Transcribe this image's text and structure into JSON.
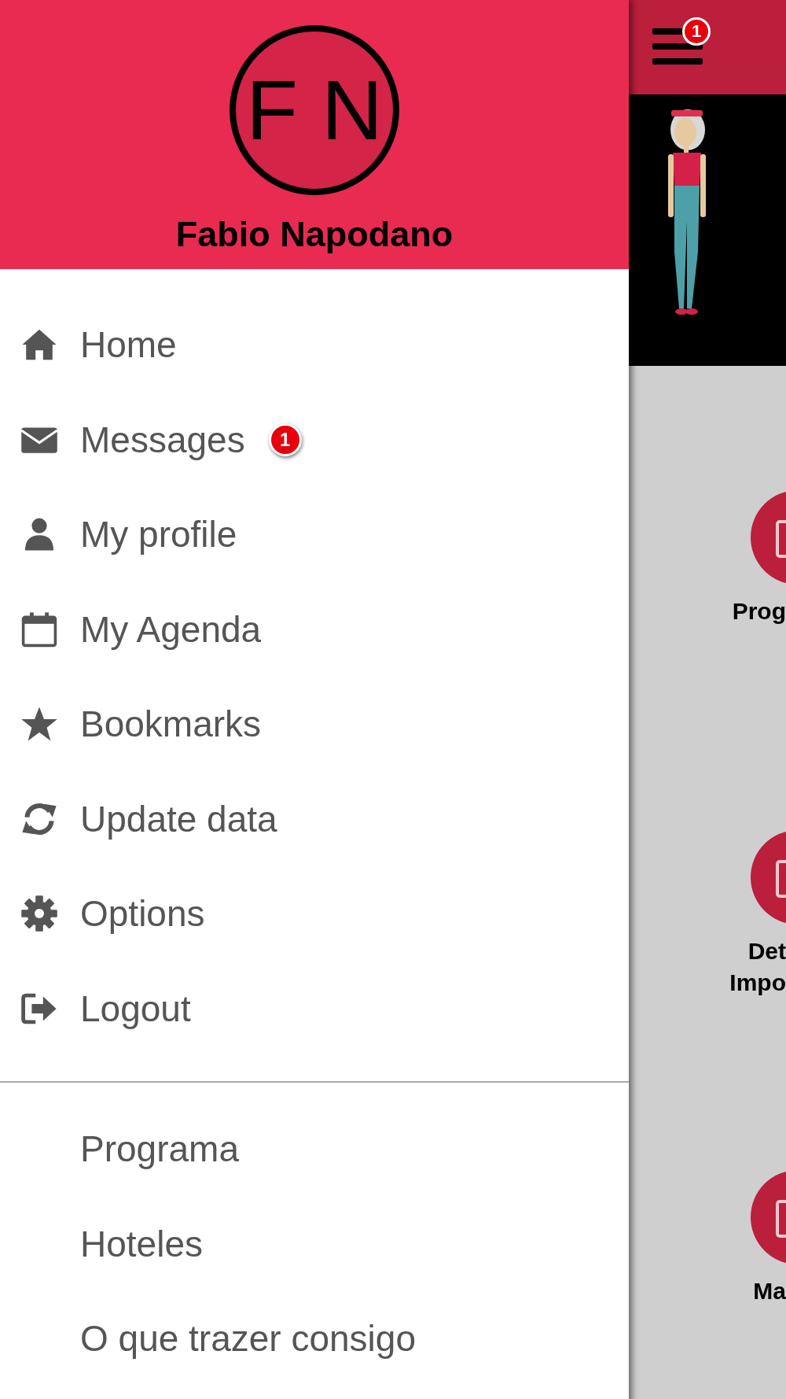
{
  "drawer": {
    "initials": "F N",
    "user_name": "Fabio Napodano",
    "menu": [
      {
        "label": "Home"
      },
      {
        "label": "Messages",
        "badge": "1"
      },
      {
        "label": "My profile"
      },
      {
        "label": "My Agenda"
      },
      {
        "label": "Bookmarks"
      },
      {
        "label": "Update data"
      },
      {
        "label": "Options"
      },
      {
        "label": "Logout"
      }
    ],
    "links": [
      {
        "label": "Programa"
      },
      {
        "label": "Hoteles"
      },
      {
        "label": "O que trazer consigo"
      }
    ]
  },
  "background_screen": {
    "menu_badge": "1",
    "tiles": [
      {
        "lines": [
          "Prog"
        ]
      },
      {
        "lines": [
          "Det",
          "Impo"
        ]
      },
      {
        "lines": [
          "Ma"
        ]
      }
    ]
  }
}
